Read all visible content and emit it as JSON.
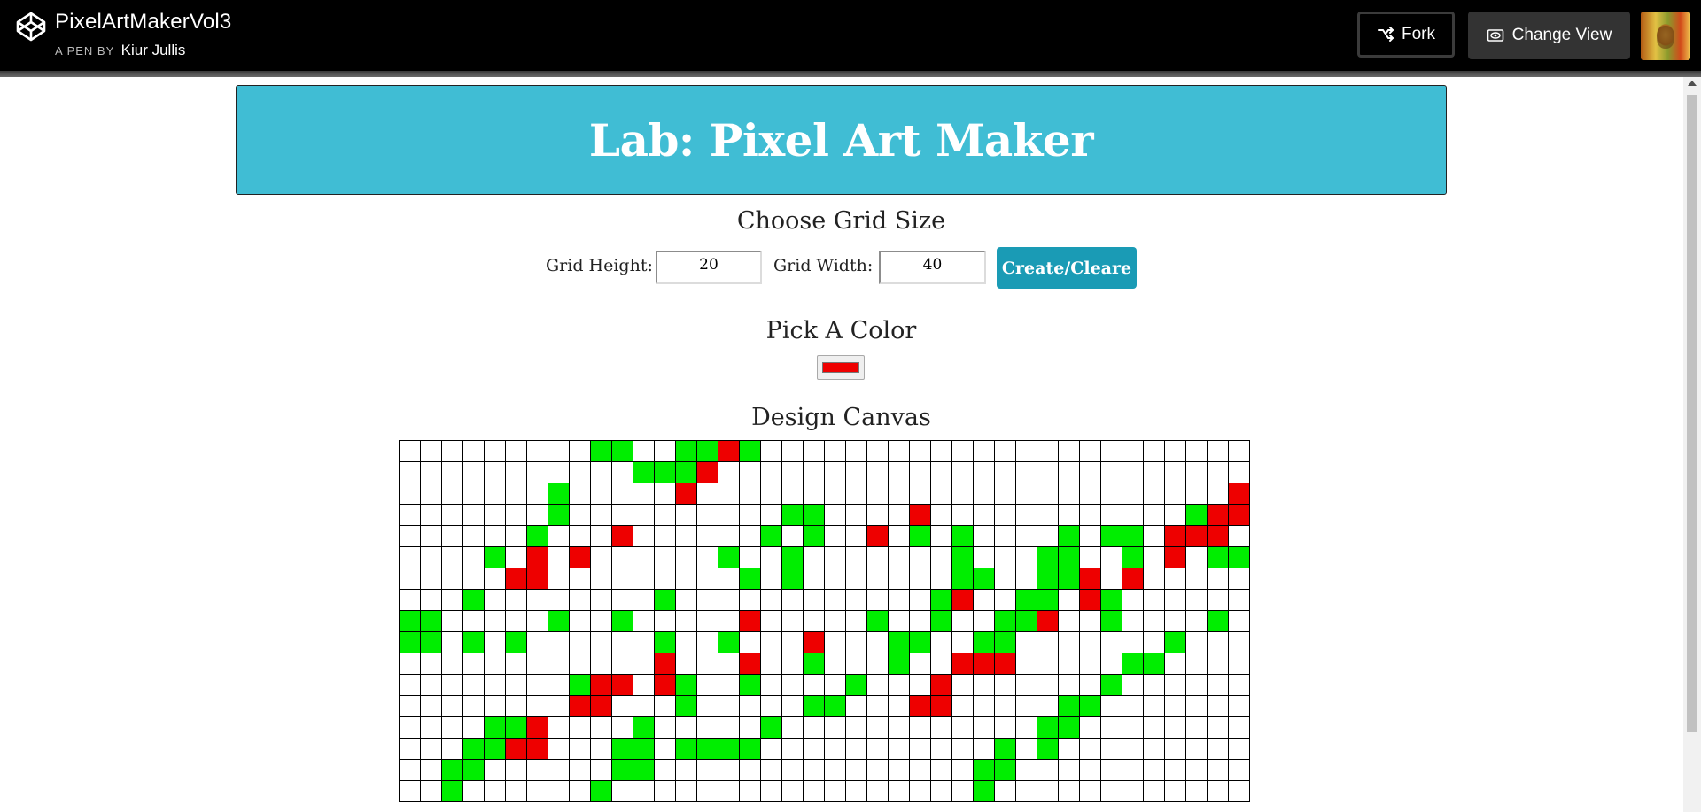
{
  "topbar": {
    "logo_icon": "codepen-logo-icon",
    "pen_title": "PixelArtMakerVol3",
    "pen_by_prefix": "A PEN BY",
    "author": "Kiur Jullis",
    "fork_label": "Fork",
    "fork_icon": "fork-icon",
    "change_view_label": "Change View",
    "change_view_icon": "eye-icon"
  },
  "page": {
    "title": "Lab: Pixel Art Maker",
    "grid_size_heading": "Choose Grid Size",
    "height_label": "Grid Height:",
    "height_value": "20",
    "width_label": "Grid Width:",
    "width_value": "40",
    "create_button": "Create/Cleare",
    "color_heading": "Pick A Color",
    "selected_color": "#ee0000",
    "canvas_heading": "Design Canvas"
  },
  "colors": {
    "banner": "#40bdd4",
    "button": "#1a9bb5",
    "green": "#00ee00",
    "red": "#ee0000"
  },
  "canvas": {
    "columns": 40,
    "visible_rows": 17,
    "cells": {
      "green": [
        [
          0,
          9
        ],
        [
          0,
          10
        ],
        [
          0,
          13
        ],
        [
          0,
          14
        ],
        [
          0,
          16
        ],
        [
          1,
          11
        ],
        [
          1,
          12
        ],
        [
          1,
          13
        ],
        [
          2,
          7
        ],
        [
          3,
          7
        ],
        [
          3,
          18
        ],
        [
          3,
          19
        ],
        [
          3,
          37
        ],
        [
          4,
          6
        ],
        [
          4,
          17
        ],
        [
          4,
          19
        ],
        [
          4,
          24
        ],
        [
          4,
          26
        ],
        [
          4,
          31
        ],
        [
          4,
          33
        ],
        [
          4,
          34
        ],
        [
          5,
          4
        ],
        [
          5,
          15
        ],
        [
          5,
          18
        ],
        [
          5,
          26
        ],
        [
          5,
          30
        ],
        [
          5,
          31
        ],
        [
          5,
          34
        ],
        [
          5,
          38
        ],
        [
          5,
          39
        ],
        [
          6,
          16
        ],
        [
          6,
          18
        ],
        [
          6,
          26
        ],
        [
          6,
          27
        ],
        [
          6,
          30
        ],
        [
          6,
          31
        ],
        [
          7,
          3
        ],
        [
          7,
          12
        ],
        [
          7,
          25
        ],
        [
          7,
          29
        ],
        [
          7,
          30
        ],
        [
          7,
          33
        ],
        [
          8,
          0
        ],
        [
          8,
          1
        ],
        [
          8,
          7
        ],
        [
          8,
          10
        ],
        [
          8,
          22
        ],
        [
          8,
          25
        ],
        [
          8,
          28
        ],
        [
          8,
          29
        ],
        [
          8,
          33
        ],
        [
          8,
          38
        ],
        [
          9,
          0
        ],
        [
          9,
          1
        ],
        [
          9,
          3
        ],
        [
          9,
          5
        ],
        [
          9,
          12
        ],
        [
          9,
          15
        ],
        [
          9,
          23
        ],
        [
          9,
          24
        ],
        [
          9,
          27
        ],
        [
          9,
          28
        ],
        [
          9,
          36
        ],
        [
          10,
          19
        ],
        [
          10,
          23
        ],
        [
          10,
          34
        ],
        [
          10,
          35
        ],
        [
          11,
          8
        ],
        [
          11,
          13
        ],
        [
          11,
          16
        ],
        [
          11,
          21
        ],
        [
          11,
          33
        ],
        [
          12,
          13
        ],
        [
          12,
          19
        ],
        [
          12,
          20
        ],
        [
          12,
          31
        ],
        [
          12,
          32
        ],
        [
          13,
          4
        ],
        [
          13,
          5
        ],
        [
          13,
          11
        ],
        [
          13,
          17
        ],
        [
          13,
          30
        ],
        [
          13,
          31
        ],
        [
          14,
          3
        ],
        [
          14,
          4
        ],
        [
          14,
          10
        ],
        [
          14,
          11
        ],
        [
          14,
          13
        ],
        [
          14,
          14
        ],
        [
          14,
          15
        ],
        [
          14,
          16
        ],
        [
          14,
          28
        ],
        [
          14,
          30
        ],
        [
          15,
          2
        ],
        [
          15,
          3
        ],
        [
          15,
          10
        ],
        [
          15,
          11
        ],
        [
          15,
          27
        ],
        [
          15,
          28
        ],
        [
          16,
          2
        ],
        [
          16,
          9
        ],
        [
          16,
          27
        ]
      ],
      "red": [
        [
          0,
          15
        ],
        [
          1,
          14
        ],
        [
          2,
          13
        ],
        [
          2,
          39
        ],
        [
          3,
          24
        ],
        [
          3,
          38
        ],
        [
          3,
          39
        ],
        [
          4,
          10
        ],
        [
          4,
          22
        ],
        [
          4,
          36
        ],
        [
          4,
          37
        ],
        [
          4,
          38
        ],
        [
          5,
          6
        ],
        [
          5,
          8
        ],
        [
          5,
          36
        ],
        [
          6,
          5
        ],
        [
          6,
          6
        ],
        [
          6,
          32
        ],
        [
          6,
          34
        ],
        [
          7,
          26
        ],
        [
          7,
          32
        ],
        [
          8,
          16
        ],
        [
          8,
          30
        ],
        [
          9,
          19
        ],
        [
          10,
          12
        ],
        [
          10,
          16
        ],
        [
          10,
          26
        ],
        [
          10,
          27
        ],
        [
          10,
          28
        ],
        [
          11,
          9
        ],
        [
          11,
          10
        ],
        [
          11,
          12
        ],
        [
          11,
          25
        ],
        [
          12,
          8
        ],
        [
          12,
          9
        ],
        [
          12,
          24
        ],
        [
          12,
          25
        ],
        [
          13,
          6
        ],
        [
          14,
          5
        ],
        [
          14,
          6
        ]
      ]
    }
  }
}
